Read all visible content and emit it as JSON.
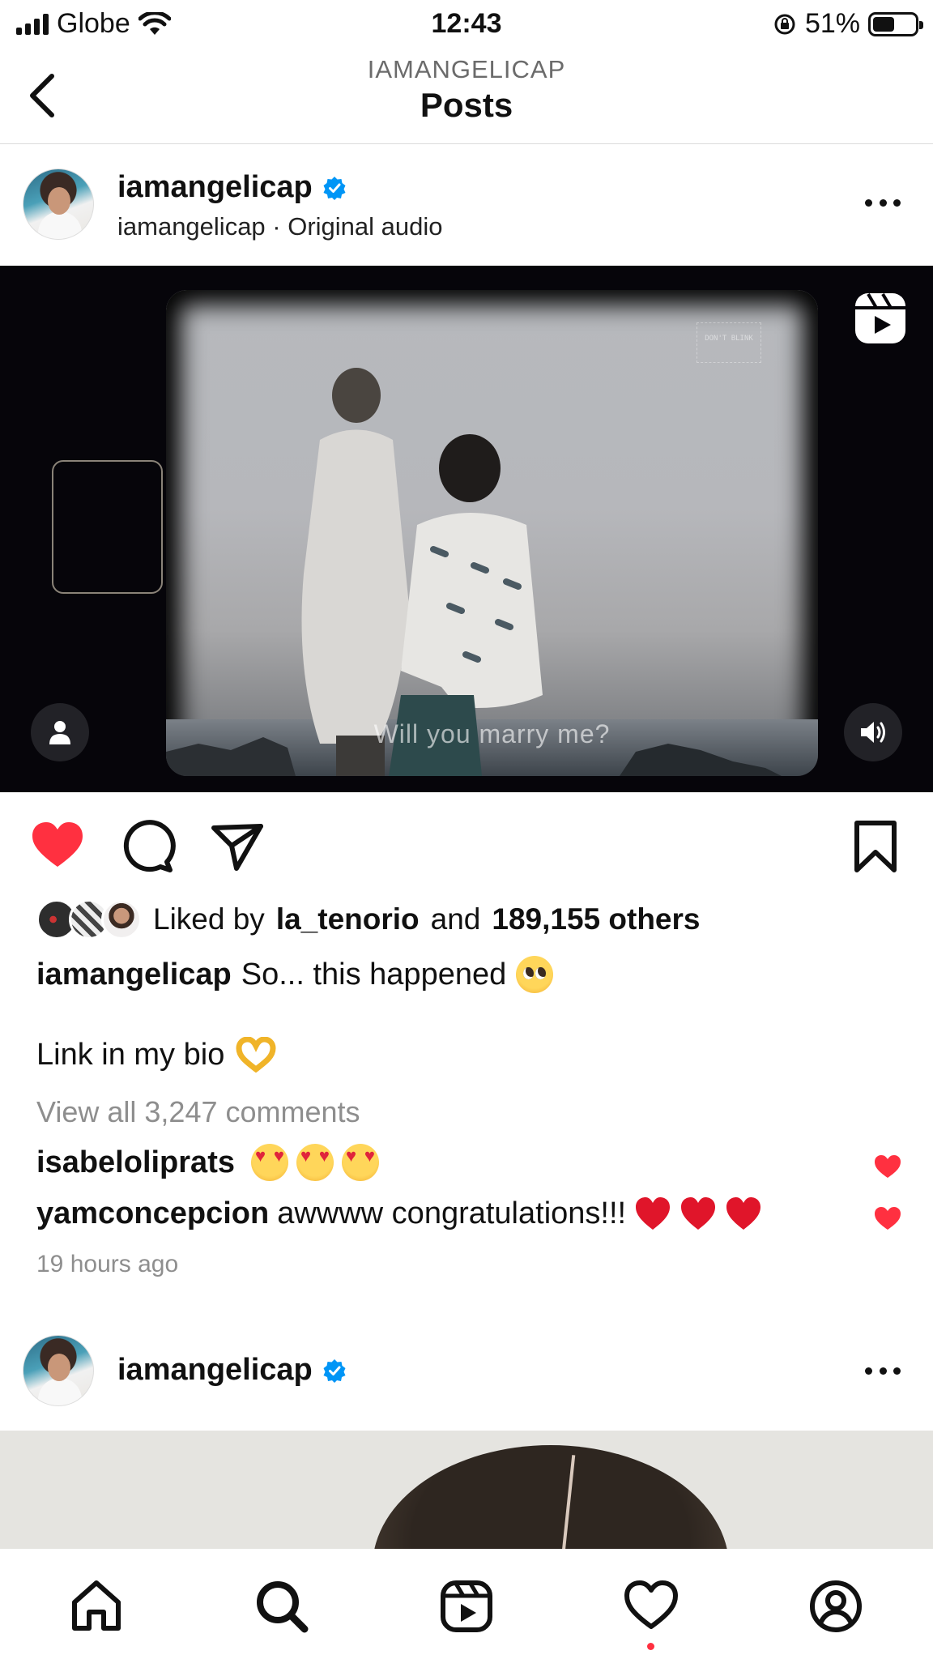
{
  "status_bar": {
    "carrier": "Globe",
    "time": "12:43",
    "battery_percent": "51%",
    "battery_level": 0.51
  },
  "header": {
    "subtitle": "IAMANGELICAP",
    "title": "Posts"
  },
  "post1": {
    "username": "iamangelicap",
    "audio": "iamangelicap · Original audio",
    "video_caption": "Will you marry me?",
    "watermark": "DON'T BLINK",
    "likes": {
      "prefix": "Liked by",
      "liker": "la_tenorio",
      "conjunction": "and",
      "others": "189,155 others"
    },
    "caption_username": "iamangelicap",
    "caption_text": "So... this happened",
    "bio_text": "Link in my bio",
    "view_comments": "View all 3,247 comments",
    "comments": [
      {
        "username": "isabeloliprats",
        "text": "",
        "emojis": [
          "heart-eyes",
          "heart-eyes",
          "heart-eyes"
        ],
        "liked": true
      },
      {
        "username": "yamconcepcion",
        "text": "awwww congratulations!!!",
        "emojis": [
          "red-heart",
          "red-heart",
          "red-heart"
        ],
        "liked": true
      }
    ],
    "timestamp": "19 hours ago",
    "liked": true
  },
  "post2": {
    "username": "iamangelicap"
  },
  "icons": {
    "back": "back-chevron-icon",
    "verified": "verified-badge-icon",
    "more": "more-horizontal-icon",
    "reels": "reels-icon",
    "like": "heart-filled-icon",
    "comment": "comment-icon",
    "share": "send-icon",
    "save": "bookmark-icon"
  },
  "colors": {
    "like_red": "#ff3040",
    "verified_blue": "#0095f6",
    "muted_text": "#8e8e8e"
  }
}
